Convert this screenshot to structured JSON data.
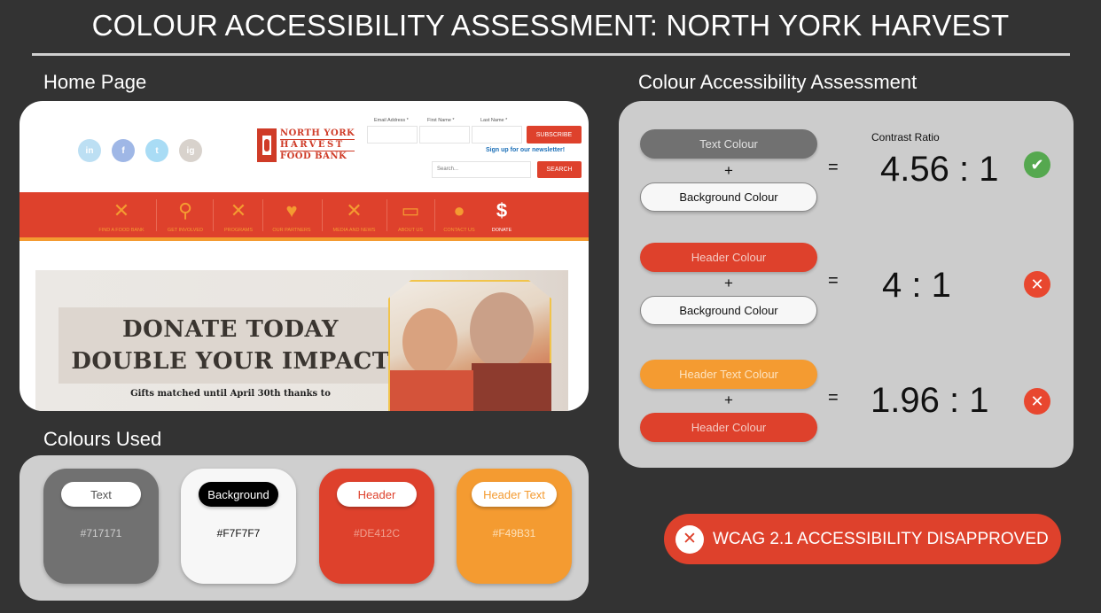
{
  "title": "COLOUR ACCESSIBILITY ASSESSMENT: NORTH YORK HARVEST",
  "home_section": {
    "heading": "Home Page",
    "social": [
      "in",
      "f",
      "t",
      "ig"
    ],
    "logo": [
      "NORTH YORK",
      "HARVEST",
      "FOOD BANK"
    ],
    "newsletter": {
      "labels": [
        "Email Address *",
        "First Name *",
        "Last Name *"
      ],
      "subscribe": "SUBSCRIBE",
      "link": "Sign up for our newsletter!",
      "search_placeholder": "Search...",
      "search_button": "SEARCH"
    },
    "nav": [
      {
        "icon": "✕",
        "label": "FIND A FOOD BANK"
      },
      {
        "icon": "⚲",
        "label": "GET INVOLVED"
      },
      {
        "icon": "✕",
        "label": "PROGRAMS"
      },
      {
        "icon": "♥",
        "label": "OUR PARTNERS"
      },
      {
        "icon": "✕",
        "label": "MEDIA AND NEWS"
      },
      {
        "icon": "▭",
        "label": "ABOUT US"
      },
      {
        "icon": "●",
        "label": "CONTACT US"
      },
      {
        "icon": "$",
        "label": "DONATE"
      }
    ],
    "hero": {
      "line1": "DONATE TODAY",
      "line2": "DOUBLE YOUR IMPACT",
      "sub": "Gifts matched until April 30th thanks to"
    }
  },
  "colours_section": {
    "heading": "Colours Used",
    "swatches": [
      {
        "label": "Text",
        "hex": "#717171"
      },
      {
        "label": "Background",
        "hex": "#F7F7F7"
      },
      {
        "label": "Header",
        "hex": "#DE412C"
      },
      {
        "label": "Header Text",
        "hex": "#F49B31"
      }
    ]
  },
  "assessment": {
    "heading": "Colour Accessibility Assessment",
    "contrast_heading": "Contrast Ratio",
    "plus": "+",
    "equals": "=",
    "rows": [
      {
        "top": "Text Colour",
        "bottom": "Background Colour",
        "ratio": "4.56 : 1",
        "status": "pass",
        "status_glyph": "✔"
      },
      {
        "top": "Header Colour",
        "bottom": "Background Colour",
        "ratio": "4 : 1",
        "status": "fail",
        "status_glyph": "✕"
      },
      {
        "top": "Header Text Colour",
        "bottom": "Header Colour",
        "ratio": "1.96 : 1",
        "status": "fail",
        "status_glyph": "✕"
      }
    ]
  },
  "verdict": {
    "icon": "✕",
    "text": "WCAG 2.1 ACCESSIBILITY DISAPPROVED"
  },
  "colors": {
    "text": "#717171",
    "background": "#F7F7F7",
    "header": "#DE412C",
    "header_text": "#F49B31",
    "pass": "#55a84f",
    "fail": "#e8472f"
  }
}
